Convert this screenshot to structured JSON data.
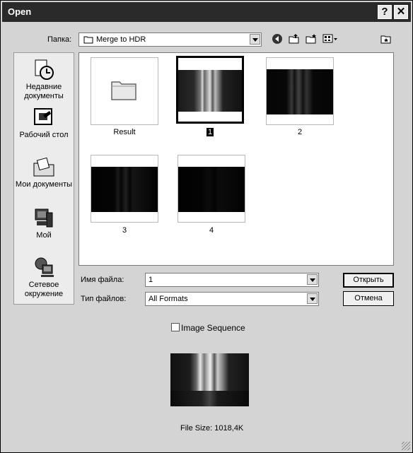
{
  "window": {
    "title": "Open",
    "help_label": "?",
    "close_label": "✕"
  },
  "lookin": {
    "label": "Папка:",
    "value": "Merge to HDR"
  },
  "places": [
    {
      "label": "Недавние документы"
    },
    {
      "label": "Рабочий стол"
    },
    {
      "label": "Мои документы"
    },
    {
      "label": "Мой"
    },
    {
      "label": "Сетевое окружение"
    }
  ],
  "files": [
    {
      "name": "Result",
      "type": "folder"
    },
    {
      "name": "1",
      "type": "image",
      "selected": true
    },
    {
      "name": "2",
      "type": "image"
    },
    {
      "name": "3",
      "type": "image"
    },
    {
      "name": "4",
      "type": "image"
    }
  ],
  "filename": {
    "label": "Имя файла:",
    "value": "1"
  },
  "filetype": {
    "label": "Тип файлов:",
    "value": "All Formats"
  },
  "buttons": {
    "open": "Открыть",
    "cancel": "Отмена"
  },
  "image_sequence": {
    "label": "Image Sequence",
    "checked": false
  },
  "file_size": "File Size: 1018,4K"
}
